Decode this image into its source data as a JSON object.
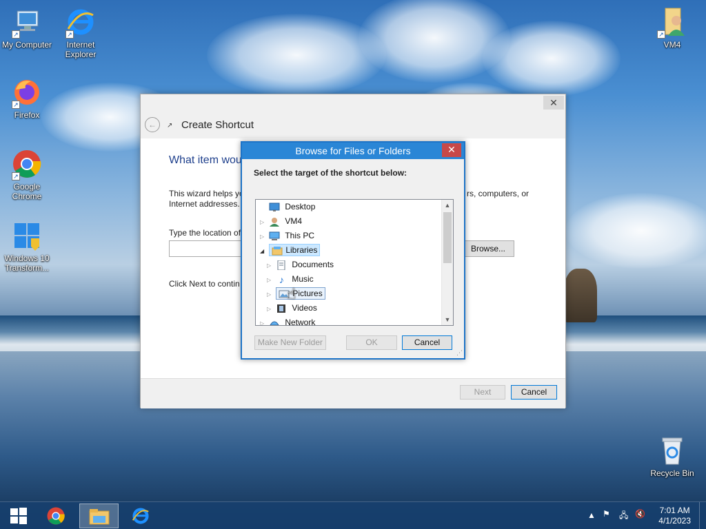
{
  "desktop": {
    "icons": [
      {
        "label": "My Computer",
        "icon": "computer-icon"
      },
      {
        "label": "Internet Explorer",
        "icon": "internet-explorer-icon"
      },
      {
        "label": "Firefox",
        "icon": "firefox-icon"
      },
      {
        "label": "Google Chrome",
        "icon": "chrome-icon"
      },
      {
        "label": "Windows 10 Transform...",
        "icon": "windows-icon"
      },
      {
        "label": "VM4",
        "icon": "user-folder-icon"
      },
      {
        "label": "Recycle Bin",
        "icon": "recycle-bin-icon"
      }
    ]
  },
  "wizard": {
    "title": "Create Shortcut",
    "close": "✕",
    "heading": "What item wou",
    "description_line1": "This wizard helps yo",
    "description_line1_end": "rs, computers, or",
    "description_line2": "Internet addresses.",
    "location_label": "Type the location of",
    "location_value": "",
    "browse_label": "Browse...",
    "next_hint": "Click Next to contin",
    "next_label": "Next",
    "cancel_label": "Cancel"
  },
  "browse_dialog": {
    "title": "Browse for Files or Folders",
    "instruction": "Select the target of the shortcut below:",
    "tree": [
      {
        "label": "Desktop",
        "icon": "desktop-icon",
        "expander": ""
      },
      {
        "label": "VM4",
        "icon": "user-icon",
        "expander": "▷"
      },
      {
        "label": "This PC",
        "icon": "this-pc-icon",
        "expander": "▷"
      },
      {
        "label": "Libraries",
        "icon": "libraries-icon",
        "expander": "◢",
        "selected": true
      },
      {
        "label": "Documents",
        "icon": "documents-icon",
        "expander": "▷"
      },
      {
        "label": "Music",
        "icon": "music-icon",
        "expander": "▷"
      },
      {
        "label": "Pictures",
        "icon": "pictures-icon",
        "expander": "▷",
        "hover": true
      },
      {
        "label": "Videos",
        "icon": "videos-icon",
        "expander": "▷"
      },
      {
        "label": "Network",
        "icon": "network-icon",
        "expander": "▷"
      }
    ],
    "make_new_folder_label": "Make New Folder",
    "ok_label": "OK",
    "cancel_label": "Cancel"
  },
  "taskbar": {
    "apps": [
      {
        "name": "start",
        "icon": "windows-start-icon"
      },
      {
        "name": "chrome",
        "icon": "chrome-icon"
      },
      {
        "name": "file-explorer",
        "icon": "folder-icon",
        "active": true
      },
      {
        "name": "internet-explorer",
        "icon": "internet-explorer-icon"
      }
    ],
    "time": "7:01 AM",
    "date": "4/1/2023"
  }
}
